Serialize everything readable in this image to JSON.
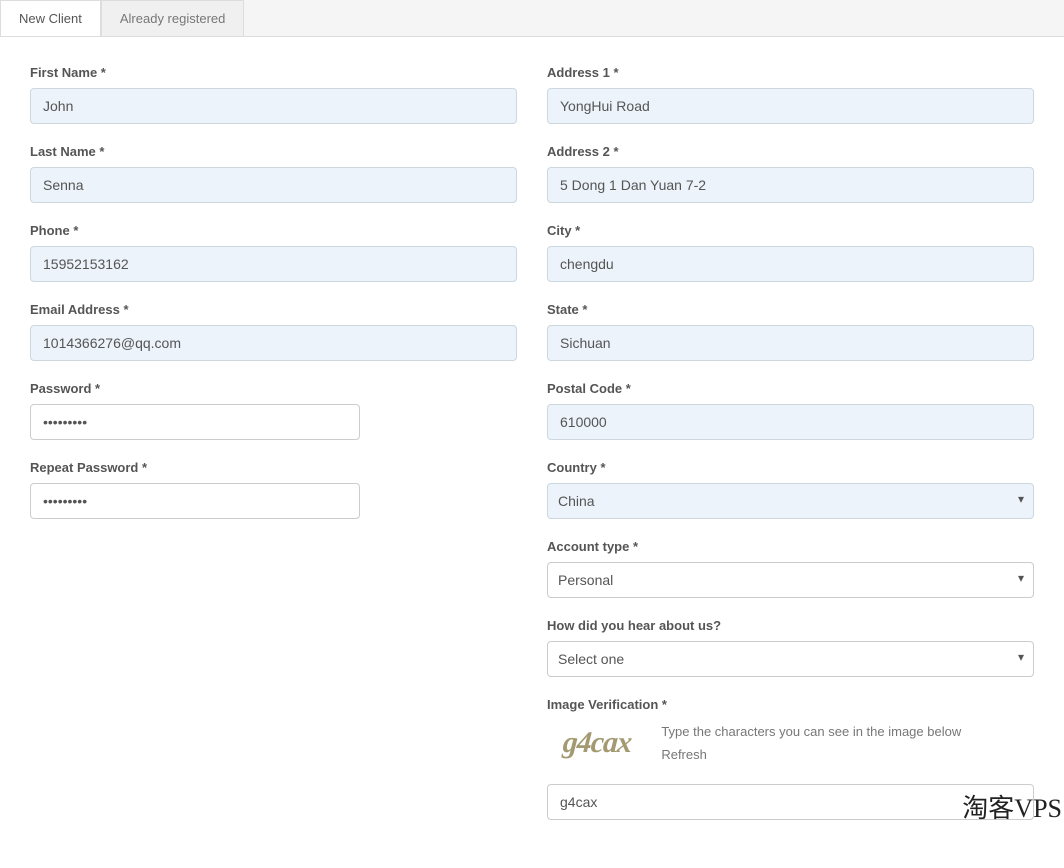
{
  "tabs": {
    "new_client": "New Client",
    "already_registered": "Already registered"
  },
  "left": {
    "first_name": {
      "label": "First Name *",
      "value": "John"
    },
    "last_name": {
      "label": "Last Name *",
      "value": "Senna"
    },
    "phone": {
      "label": "Phone *",
      "value": "15952153162"
    },
    "email": {
      "label": "Email Address *",
      "value": "1014366276@qq.com"
    },
    "password": {
      "label": "Password *",
      "value": "•••••••••"
    },
    "repeat_password": {
      "label": "Repeat Password *",
      "value": "•••••••••"
    }
  },
  "right": {
    "address1": {
      "label": "Address 1 *",
      "value": "YongHui Road"
    },
    "address2": {
      "label": "Address 2 *",
      "value": "5 Dong 1 Dan Yuan 7-2"
    },
    "city": {
      "label": "City *",
      "value": "chengdu"
    },
    "state": {
      "label": "State *",
      "value": "Sichuan"
    },
    "postal_code": {
      "label": "Postal Code *",
      "value": "610000"
    },
    "country": {
      "label": "Country *",
      "value": "China"
    },
    "account_type": {
      "label": "Account type *",
      "value": "Personal"
    },
    "hear_about": {
      "label": "How did you hear about us?",
      "value": "Select one"
    },
    "verification": {
      "label": "Image Verification *",
      "captcha_text": "g4cax",
      "help": "Type the characters you can see in the image below",
      "refresh": "Refresh",
      "input_value": "g4cax"
    }
  },
  "watermark": "淘客VPS"
}
